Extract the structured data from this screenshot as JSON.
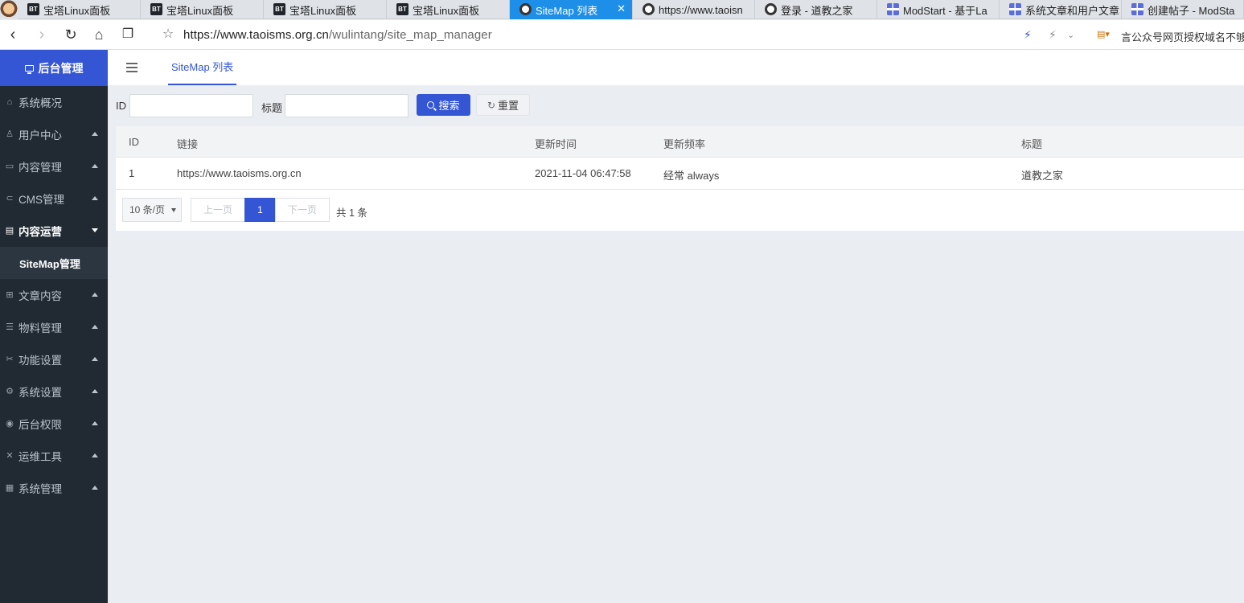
{
  "browser": {
    "tabs": [
      {
        "label": "宝塔Linux面板",
        "icon": "bt-icon"
      },
      {
        "label": "宝塔Linux面板",
        "icon": "bt-icon"
      },
      {
        "label": "宝塔Linux面板",
        "icon": "bt-icon"
      },
      {
        "label": "宝塔Linux面板",
        "icon": "bt-icon"
      },
      {
        "label": "SiteMap 列表",
        "icon": "eye-icon",
        "active": true
      },
      {
        "label": "https://www.taoisn",
        "icon": "eye-icon"
      },
      {
        "label": "登录 - 道教之家",
        "icon": "eye-icon"
      },
      {
        "label": "ModStart - 基于La",
        "icon": "grid-icon"
      },
      {
        "label": "系统文章和用户文章",
        "icon": "grid-icon"
      },
      {
        "label": "创建帖子 - ModSta",
        "icon": "grid-icon"
      }
    ],
    "tab_close": "✕",
    "url_host": "https://www.taoisms.org.cn",
    "url_path": "/wulintang/site_map_manager",
    "right_notice": "言公众号网页授权域名不够"
  },
  "sidebar": {
    "brand": "后台管理",
    "items": [
      {
        "label": "系统概况",
        "icon": "home-icon"
      },
      {
        "label": "用户中心",
        "icon": "users-icon"
      },
      {
        "label": "内容管理",
        "icon": "file-icon"
      },
      {
        "label": "CMS管理",
        "icon": "cms-icon"
      },
      {
        "label": "内容运营",
        "icon": "doc-icon"
      },
      {
        "label": "SiteMap管理"
      },
      {
        "label": "文章内容",
        "icon": "apps-icon"
      },
      {
        "label": "物料管理",
        "icon": "list-icon"
      },
      {
        "label": "功能设置",
        "icon": "tools-icon"
      },
      {
        "label": "系统设置",
        "icon": "gear-icon"
      },
      {
        "label": "后台权限",
        "icon": "user-circle-icon"
      },
      {
        "label": "运维工具",
        "icon": "wrench-icon"
      },
      {
        "label": "系统管理",
        "icon": "chart-icon"
      }
    ]
  },
  "header": {
    "tab": "SiteMap 列表"
  },
  "search": {
    "id_label": "ID",
    "title_label": "标题",
    "id_value": "",
    "title_value": "",
    "search_button": "搜索",
    "reset_button": "重置"
  },
  "table": {
    "columns": [
      "ID",
      "链接",
      "更新时间",
      "更新频率",
      "标题"
    ],
    "rows": [
      [
        "1",
        "https://www.taoisms.org.cn",
        "2021-11-04 06:47:58",
        "经常 always",
        "道教之家"
      ]
    ]
  },
  "pagination": {
    "page_size": "10 条/页",
    "prev": "上一页",
    "current": "1",
    "next": "下一页",
    "total": "共 1 条"
  }
}
